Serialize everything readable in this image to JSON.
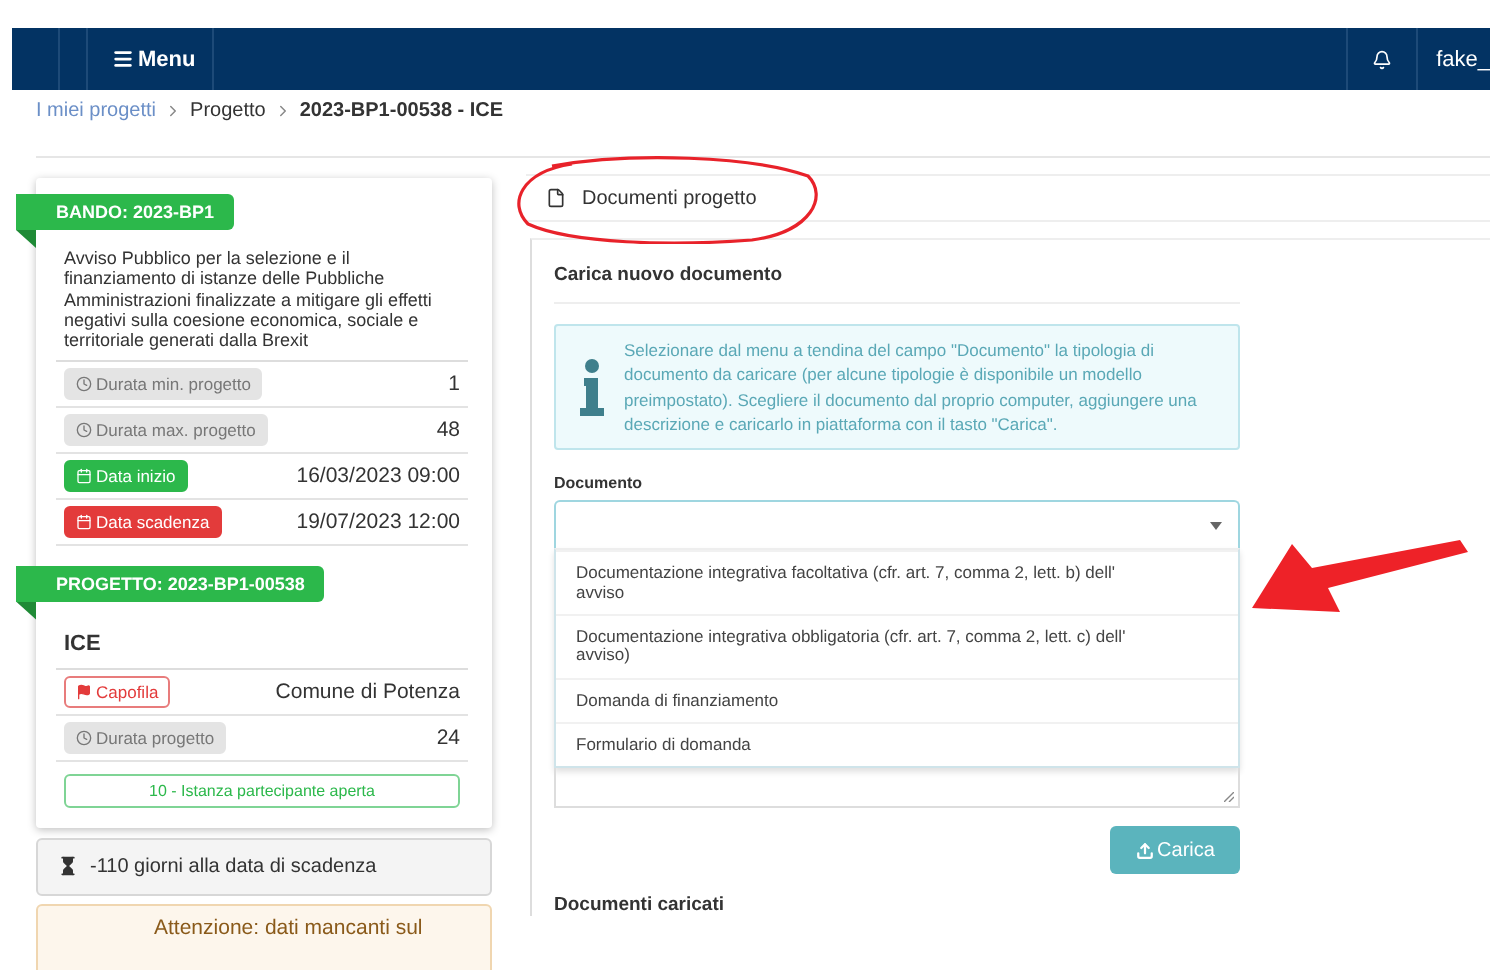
{
  "navbar": {
    "menu_label": "Menu",
    "user": "fake_"
  },
  "breadcrumb": [
    {
      "label": "I miei progetti",
      "kind": "link"
    },
    {
      "label": "Progetto",
      "kind": "plain"
    },
    {
      "label": "2023-BP1-00538 - ICE",
      "kind": "current"
    }
  ],
  "bando": {
    "ribbon": "BANDO: 2023-BP1",
    "description": "Avviso Pubblico per la selezione e il finanziamento di istanze delle Pubbliche Amministrazioni finalizzate a mitigare gli effetti negativi sulla coesione economica, sociale e territoriale generati dalla Brexit",
    "rows": [
      {
        "label": "Durata min. progetto",
        "kind": "grey",
        "value": "1"
      },
      {
        "label": "Durata max. progetto",
        "kind": "grey",
        "value": "48"
      },
      {
        "label": "Data inizio",
        "kind": "green",
        "value": "16/03/2023 09:00"
      },
      {
        "label": "Data scadenza",
        "kind": "red",
        "value": "19/07/2023 12:00"
      }
    ]
  },
  "progetto": {
    "ribbon": "PROGETTO: 2023-BP1-00538",
    "title": "ICE",
    "rows": [
      {
        "label": "Capofila",
        "kind": "outline-red",
        "value": "Comune di Potenza"
      },
      {
        "label": "Durata progetto",
        "kind": "grey",
        "value": "24"
      }
    ],
    "status": "10 - Istanza partecipante aperta"
  },
  "deadline": "-110 giorni alla data di scadenza",
  "warning": "Attenzione: dati mancanti sul",
  "documents_tab": "Documenti progetto",
  "upload": {
    "title": "Carica nuovo documento",
    "info": "Selezionare dal menu a tendina del campo \"Documento\" la tipologia di documento da caricare (per alcune tipologie è disponibile un modello preimpostato). Scegliere il documento dal proprio computer, aggiungere una descrizione e caricarlo in piattaforma con il tasto \"Carica\".",
    "field_label": "Documento",
    "options": [
      "Documentazione integrativa facoltativa (cfr. art. 7, comma 2, lett. b) dell' avviso",
      "Documentazione integrativa obbligatoria (cfr. art. 7, comma 2, lett. c) dell' avviso)",
      "Domanda di finanziamento",
      "Formulario di domanda"
    ],
    "button": "Carica"
  },
  "uploaded_title": "Documenti caricati"
}
